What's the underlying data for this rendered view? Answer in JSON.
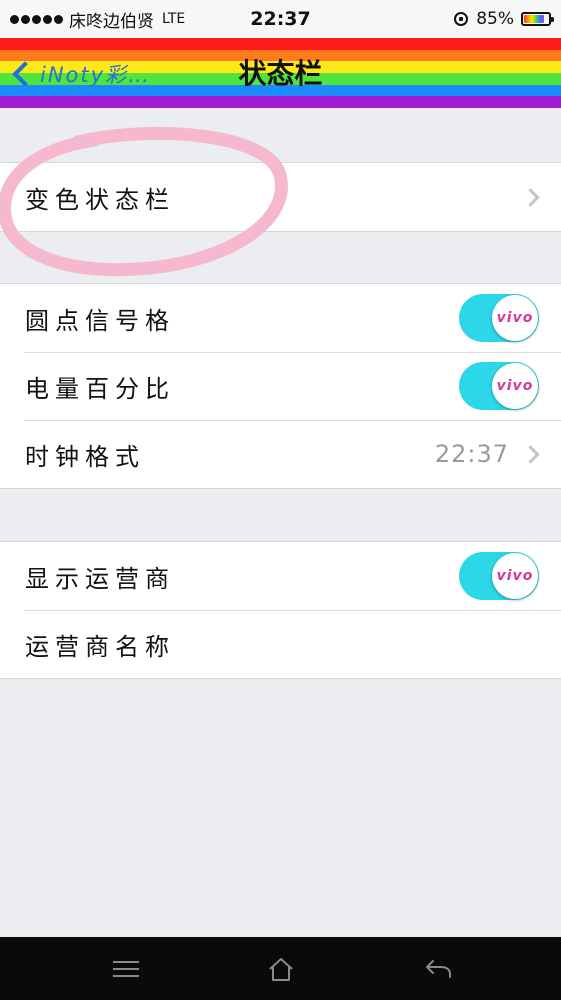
{
  "status_bar": {
    "carrier": "床咚边伯贤",
    "network": "LTE",
    "time": "22:37",
    "battery_text": "85%",
    "battery_level": 0.85
  },
  "nav": {
    "back_label": "iNoty彩…",
    "title": "状态栏",
    "rainbow_colors": [
      "#ff1a1a",
      "#ff7a1a",
      "#ffe81a",
      "#4ee63c",
      "#1a8cff",
      "#a21ad6"
    ]
  },
  "groups": [
    {
      "rows": [
        {
          "label": "变色状态栏",
          "type": "disclosure"
        }
      ]
    },
    {
      "rows": [
        {
          "label": "圆点信号格",
          "type": "toggle",
          "on": true,
          "knob_text": "vivo"
        },
        {
          "label": "电量百分比",
          "type": "toggle",
          "on": true,
          "knob_text": "vivo"
        },
        {
          "label": "时钟格式",
          "type": "disclosure",
          "value": "22:37"
        }
      ]
    },
    {
      "rows": [
        {
          "label": "显示运营商",
          "type": "toggle",
          "on": true,
          "knob_text": "vivo"
        },
        {
          "label": "运营商名称",
          "type": "plain"
        }
      ]
    }
  ],
  "colors": {
    "toggle_on": "#2bd7e8",
    "knob_text": "#d6379a",
    "annotation_circle": "#f5b8cf",
    "back_link": "#1f6fe0"
  }
}
